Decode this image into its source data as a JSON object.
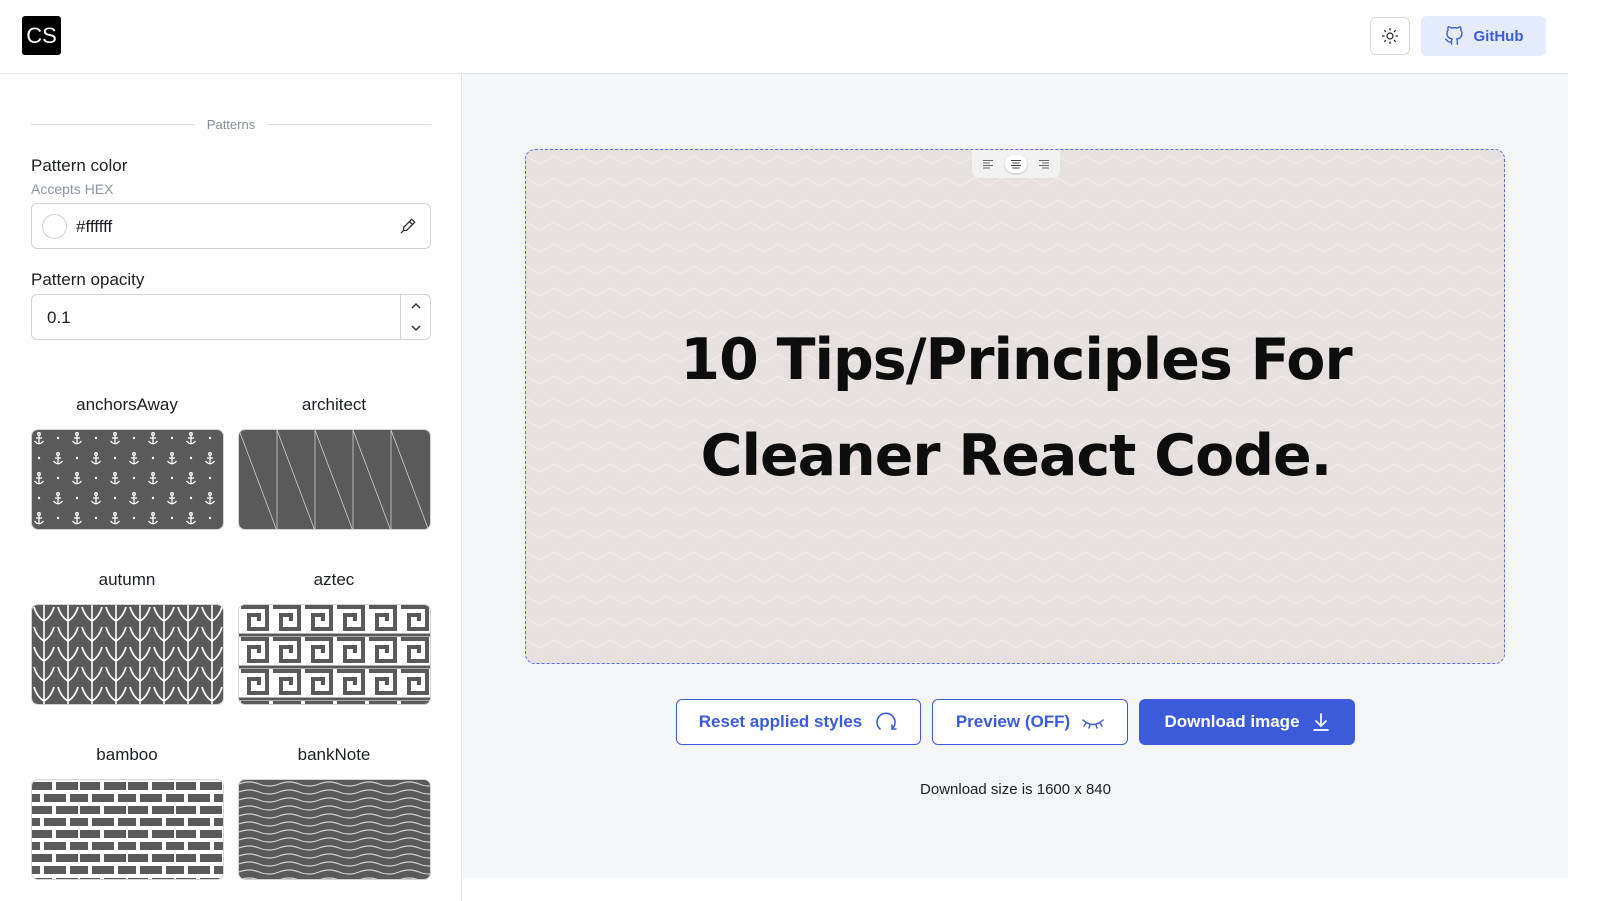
{
  "header": {
    "logo_text": "CS",
    "theme_icon": "sun-icon",
    "github_label": "GitHub",
    "github_icon": "github-icon"
  },
  "sidebar": {
    "section_label": "Patterns",
    "pattern_color": {
      "label": "Pattern color",
      "hint": "Accepts HEX",
      "value": "#ffffff"
    },
    "pattern_opacity": {
      "label": "Pattern opacity",
      "value": "0.1"
    },
    "patterns": [
      {
        "name": "anchorsAway"
      },
      {
        "name": "architect"
      },
      {
        "name": "autumn"
      },
      {
        "name": "aztec"
      },
      {
        "name": "bamboo"
      },
      {
        "name": "bankNote"
      }
    ]
  },
  "preview": {
    "headline": "10 Tips/Principles For Cleaner React Code.",
    "text_align": "center",
    "background_color": "#e6e0df"
  },
  "actions": {
    "reset_label": "Reset applied styles",
    "preview_label": "Preview (OFF)",
    "download_label": "Download image",
    "download_size_text": "Download size is 1600 x 840"
  },
  "colors": {
    "accent": "#3b5bdb",
    "tile_dark": "#5a5a5a"
  }
}
